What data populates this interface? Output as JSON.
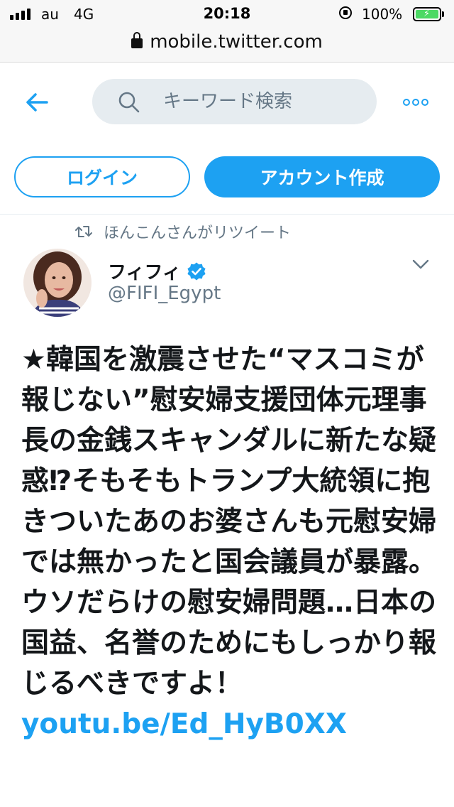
{
  "status_bar": {
    "carrier": "au",
    "network": "4G",
    "time": "20:18",
    "battery_percent": "100%",
    "battery_level": 1.0,
    "battery_color": "#4cd964"
  },
  "browser": {
    "url": "mobile.twitter.com"
  },
  "nav": {
    "back_icon": "arrow-left-icon",
    "search_placeholder": "キーワード検索",
    "search_icon": "search-icon",
    "more_icon": "more-dots-icon"
  },
  "auth": {
    "login_label": "ログイン",
    "signup_label": "アカウント作成"
  },
  "tweet": {
    "retweet_context": "ほんこんさんがリツイート",
    "author_name": "フィフィ",
    "author_handle": "@FIFI_Egypt",
    "verified": true,
    "text": "★韓国を激震させた“マスコミが報じない”慰安婦支援団体元理事長の金銭スキャンダルに新たな疑惑⁉そもそもトランプ大統領に抱きついたあのお婆さんも元慰安婦では無かったと国会議員が暴露。ウソだらけの慰安婦問題…日本の国益、名誉のためにもしっかり報じるべきですよ！",
    "link": "youtu.be/Ed_HyB0XX"
  },
  "colors": {
    "accent": "#1da1f2",
    "text": "#14171a",
    "secondary_text": "#657786",
    "search_bg": "#e6ecf0"
  }
}
